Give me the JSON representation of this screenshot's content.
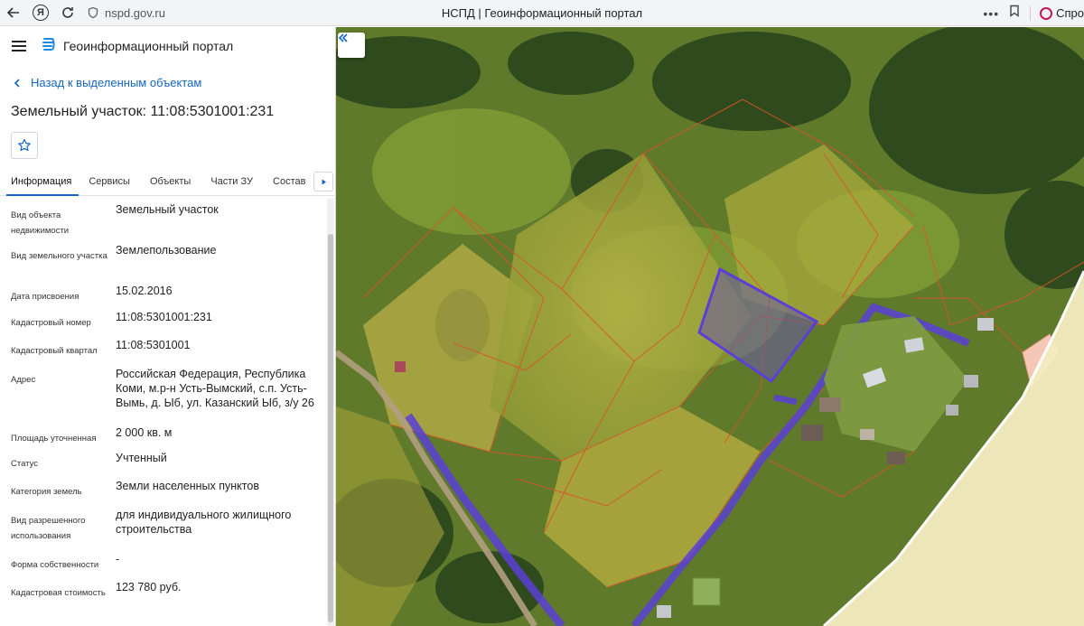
{
  "browser": {
    "url": "nspd.gov.ru",
    "title": "НСПД | Геоинформационный портал",
    "ask_label": "Спро"
  },
  "header": {
    "title": "Геоинформационный портал"
  },
  "nav": {
    "back_label": "Назад к выделенным объектам"
  },
  "object": {
    "title": "Земельный участок: 11:08:5301001:231"
  },
  "tabs": [
    {
      "label": "Информация",
      "active": true
    },
    {
      "label": "Сервисы",
      "active": false
    },
    {
      "label": "Объекты",
      "active": false
    },
    {
      "label": "Части ЗУ",
      "active": false
    },
    {
      "label": "Состав",
      "active": false
    }
  ],
  "info": {
    "type_label": "Вид объекта недвижимости",
    "type_value": "Земельный участок",
    "parcel_type_label": "Вид земельного участка",
    "parcel_type_value": "Землепользование",
    "date_label": "Дата присвоения",
    "date_value": "15.02.2016",
    "cad_num_label": "Кадастровый номер",
    "cad_num_value": "11:08:5301001:231",
    "cad_block_label": "Кадастровый квартал",
    "cad_block_value": "11:08:5301001",
    "address_label": "Адрес",
    "address_value": "Российская Федерация, Республика Коми, м.р-н Усть-Вымский, с.п. Усть-Вымь, д. Ыб, ул. Казанский Ыб, з/у 26",
    "area_label": "Площадь уточненная",
    "area_value": "2 000 кв. м",
    "status_label": "Статус",
    "status_value": "Учтенный",
    "category_label": "Категория земель",
    "category_value": "Земли населенных пунктов",
    "usage_label": "Вид разрешенного использования",
    "usage_value": "для индивидуального жилищного строительства",
    "ownership_label": "Форма собственности",
    "ownership_value": "-",
    "cost_label": "Кадастровая стоимость",
    "cost_value": "123 780 руб."
  },
  "colors": {
    "accent": "#1565c0",
    "selected_parcel": "#5b3fd6",
    "boundary": "#d9542b"
  }
}
